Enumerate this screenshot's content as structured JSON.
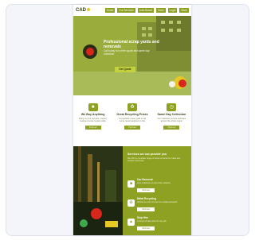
{
  "page": {
    "logo": "CAD",
    "nav": [
      "Home",
      "Our Services",
      "Jobs Board",
      "Team",
      "Login",
      "Store"
    ],
    "hero": {
      "title": "Professional scrap yards and removals",
      "subtitle": "Call today for a free quote and same day collection",
      "button": "Get Quote"
    },
    "features": [
      {
        "title": "We Buy Anything",
        "text": "Bring us your old cars, copper, lead and scrap metals today",
        "button": "Find out",
        "icon": "truck-icon"
      },
      {
        "title": "Great Recycling Prices",
        "text": "Competitive prices paid on all scrap metal weighed on site",
        "button": "Find out",
        "icon": "recycle-icon"
      },
      {
        "title": "Same Day Collection",
        "text": "Our collection service operates across the whole region",
        "button": "Find out",
        "icon": "clock-icon"
      }
    ],
    "services": {
      "title": "Services we can provide you",
      "text": "We offer a complete range of scrap services for trade and private customers.",
      "items": [
        {
          "title": "Car Removal",
          "text": "Free collection of end of life vehicles.",
          "button": "Find out",
          "icon": "car-icon"
        },
        {
          "title": "Metal Recycling",
          "text": "All ferrous and non ferrous metals accepted.",
          "button": "Find out",
          "icon": "recycle-icon"
        },
        {
          "title": "Skip Hire",
          "text": "A range of skip sizes for any job.",
          "button": "Find out",
          "icon": "skip-icon"
        }
      ]
    }
  },
  "colors": {
    "brand_green": "#8ea123",
    "hero_green": "#9aad3c",
    "accent_red": "#d7261c",
    "accent_yellow": "#e5c823"
  }
}
